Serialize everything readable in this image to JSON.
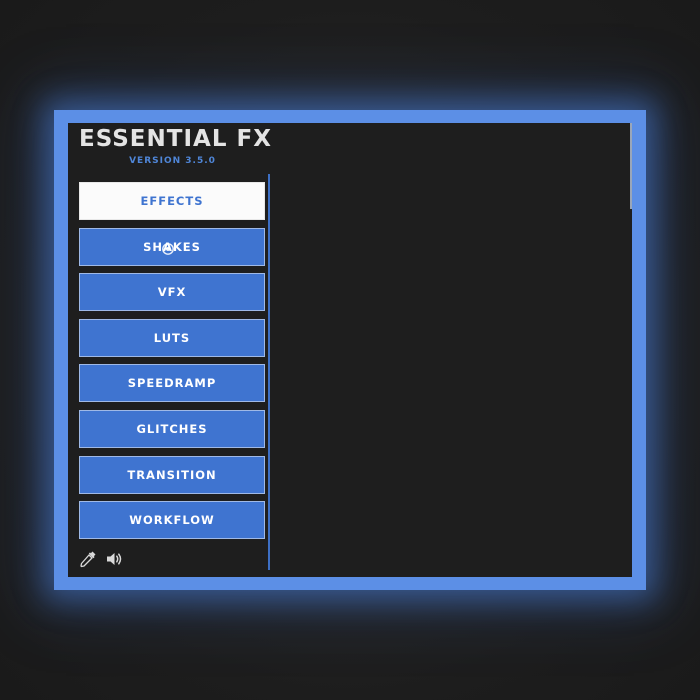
{
  "app": {
    "title": "ESSENTIAL FX",
    "version": "VERSION 3.5.0"
  },
  "nav": {
    "items": [
      {
        "label": "EFFECTS",
        "active": true
      },
      {
        "label": "SHAKES",
        "active": false
      },
      {
        "label": "VFX",
        "active": false
      },
      {
        "label": "LUTS",
        "active": false
      },
      {
        "label": "SPEEDRAMP",
        "active": false
      },
      {
        "label": "GLITCHES",
        "active": false
      },
      {
        "label": "TRANSITION",
        "active": false
      },
      {
        "label": "WORKFLOW",
        "active": false
      }
    ]
  },
  "footer": {
    "icons": [
      "eyedropper-icon",
      "speaker-icon"
    ]
  },
  "colors": {
    "accent": "#3f74d0",
    "frame_glow": "#5c8fe6",
    "panel_bg": "#1e1e1e",
    "active_bg": "#fbfbfb"
  }
}
